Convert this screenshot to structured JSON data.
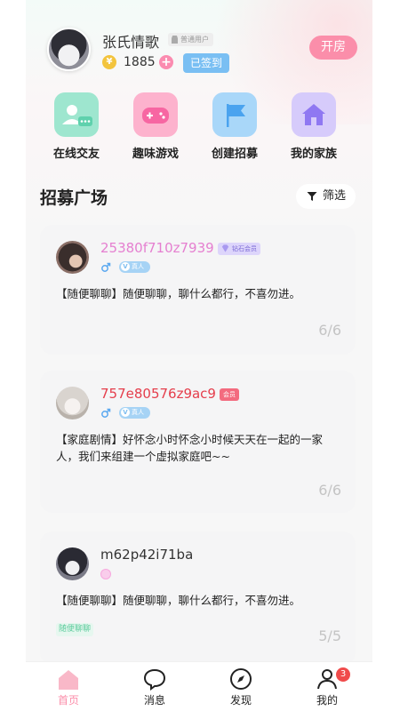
{
  "profile": {
    "name": "张氏情歌",
    "role_tag": "普通用户",
    "coins": "1885",
    "checkin_label": "已签到",
    "open_room_label": "开房"
  },
  "quick_menu": [
    {
      "label": "在线交友",
      "icon": "chat-people-icon"
    },
    {
      "label": "趣味游戏",
      "icon": "gamepad-icon"
    },
    {
      "label": "创建招募",
      "icon": "flag-icon"
    },
    {
      "label": "我的家族",
      "icon": "home-icon"
    }
  ],
  "section": {
    "title": "招募广场",
    "filter_label": "筛选"
  },
  "cards": [
    {
      "username": "25380f710z7939",
      "username_color": "#e57fd0",
      "badge": "钻石会员",
      "gender": "♂",
      "real_label": "真人",
      "description": "【随便聊聊】随便聊聊，聊什么都行，不喜勿进。",
      "count": "6/6"
    },
    {
      "username": "757e80576z9ac9",
      "username_color": "#e53e4c",
      "badge": "会员",
      "gender": "♂",
      "real_label": "真人",
      "description": "【家庭剧情】好怀念小时怀念小时候天天在一起的一家人，我们来组建一个虚拟家庭吧~~",
      "count": "6/6"
    },
    {
      "username": "m62p42i71ba",
      "username_color": "#333333",
      "description": "【随便聊聊】随便聊聊，聊什么都行，不喜勿进。",
      "tag": "随便聊聊",
      "count": "5/5"
    }
  ],
  "nav": {
    "items": [
      {
        "label": "首页",
        "icon": "home-icon",
        "active": true
      },
      {
        "label": "消息",
        "icon": "message-icon"
      },
      {
        "label": "发现",
        "icon": "compass-icon"
      },
      {
        "label": "我的",
        "icon": "person-icon"
      }
    ],
    "badge_count": "3"
  },
  "colors": {
    "accent_pink": "#fb8eaa",
    "accent_blue": "#79bff3"
  }
}
